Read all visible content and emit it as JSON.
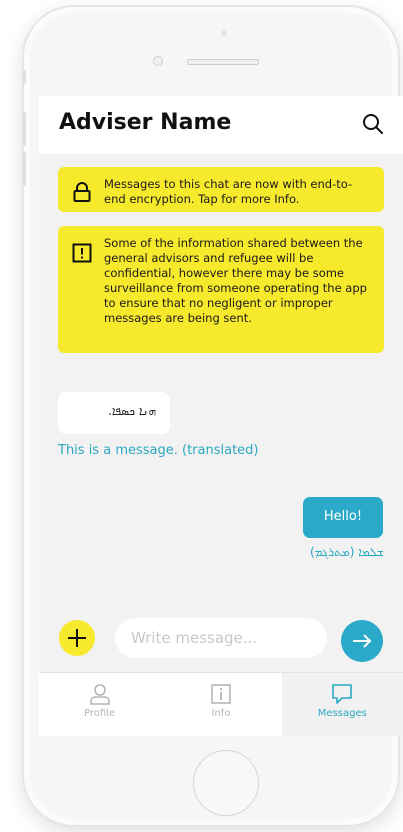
{
  "header": {
    "title": "Adviser Name"
  },
  "notices": {
    "encryption": "Messages to this chat are now with end-to-end encryption. Tap for more Info.",
    "surveillance": "Some of the information shared between the general advisors  and refugee will be confidential, however there may be some surveillance from someone operating the app to ensure that no negligent or improper messages are being sent."
  },
  "messages": {
    "incoming_text": "ܗܢܐ ܟܣܦܐ.",
    "incoming_translation": "This is a message. (translated)",
    "outgoing_text": "Hello!",
    "outgoing_translation": "ܫܠܡܐ (ܡܬܪܓܡ)"
  },
  "composer": {
    "placeholder": "Write message..."
  },
  "tabs": [
    {
      "label": "Profile",
      "icon": "person-icon"
    },
    {
      "label": "Info",
      "icon": "info-icon"
    },
    {
      "label": "Messages",
      "icon": "message-icon"
    }
  ],
  "colors": {
    "accent": "#2aa9c9",
    "notice": "#f7e92b"
  }
}
